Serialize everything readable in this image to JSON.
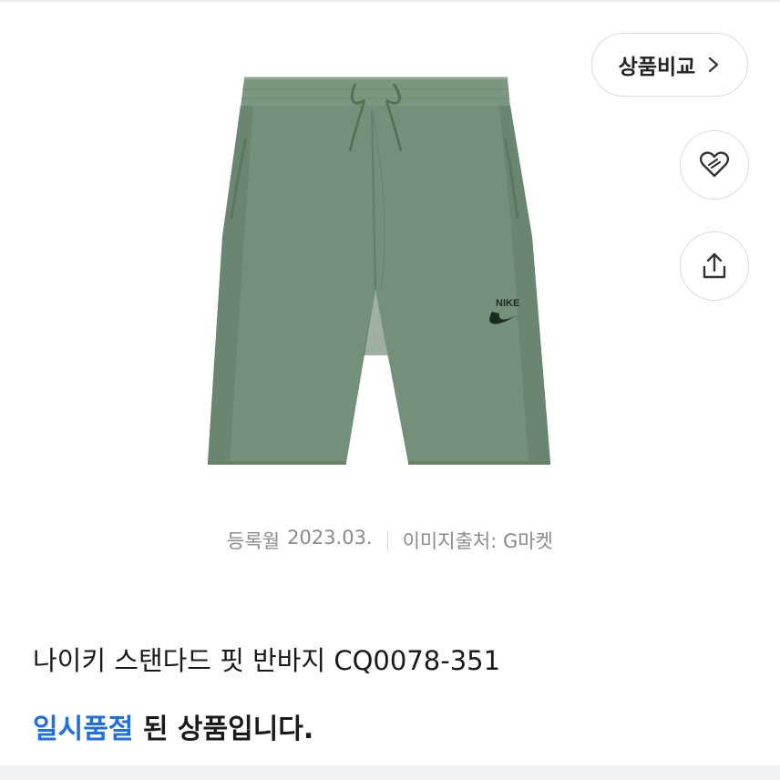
{
  "product": {
    "image_icon": "nike-shorts-product-image",
    "title": "나이키 스탠다드 핏 반바지 CQ0078-351",
    "reg_label": "등록월",
    "reg_value": "2023.03.",
    "image_source": "이미지출처: G마켓"
  },
  "actions": {
    "compare_label": "상품비교",
    "compare_icon": "chevron-right-icon",
    "wish_icon": "heart-icon",
    "share_icon": "share-icon"
  },
  "status": {
    "highlight": "일시품절",
    "rest": " 된 상품입니다."
  },
  "colors": {
    "accent": "#1f6fe0",
    "shorts": "#74907a",
    "border": "#dcdcdc",
    "meta_text": "#8a8a8a"
  }
}
